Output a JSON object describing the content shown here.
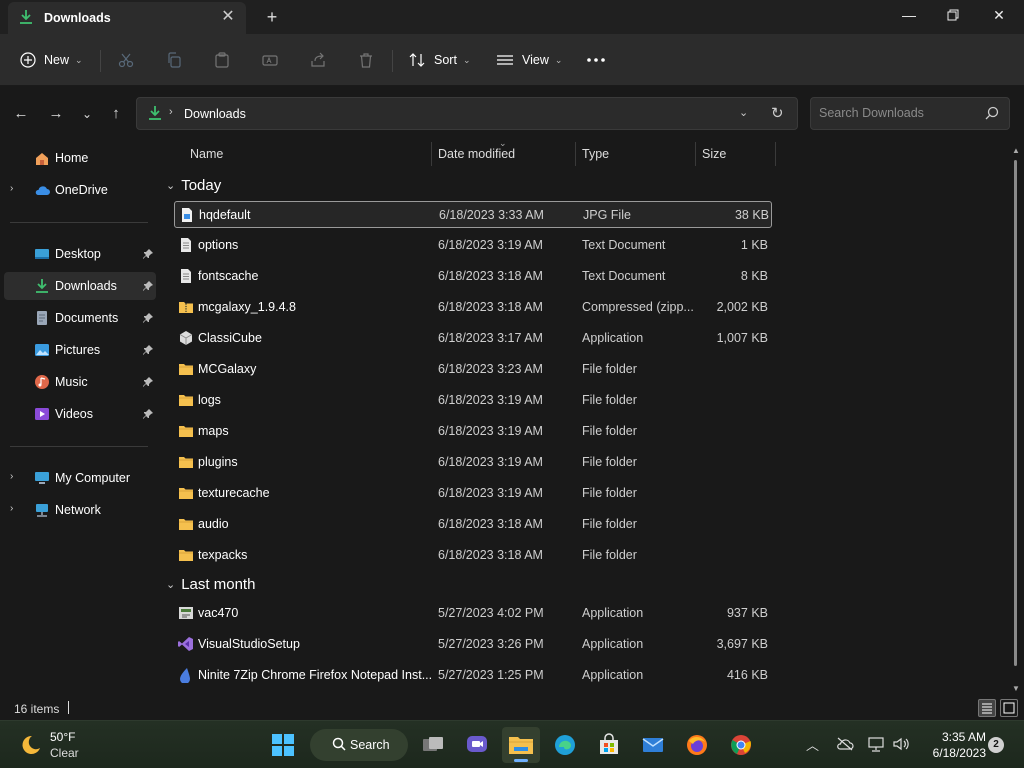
{
  "window": {
    "tab_title": "Downloads",
    "new_tab_icon": "plus-icon"
  },
  "toolbar": {
    "new_label": "New",
    "sort_label": "Sort",
    "view_label": "View"
  },
  "address": {
    "crumb": "Downloads",
    "search_placeholder": "Search Downloads"
  },
  "navigation": {
    "items": [
      {
        "label": "Home",
        "icon": "home-icon",
        "pinned": false
      },
      {
        "label": "OneDrive",
        "icon": "cloud-icon",
        "pinned": false
      },
      {
        "label": "Desktop",
        "icon": "desktop-icon",
        "pinned": true
      },
      {
        "label": "Downloads",
        "icon": "download-icon",
        "pinned": true
      },
      {
        "label": "Documents",
        "icon": "documents-icon",
        "pinned": true
      },
      {
        "label": "Pictures",
        "icon": "pictures-icon",
        "pinned": true
      },
      {
        "label": "Music",
        "icon": "music-icon",
        "pinned": true
      },
      {
        "label": "Videos",
        "icon": "videos-icon",
        "pinned": true
      },
      {
        "label": "My Computer",
        "icon": "computer-icon",
        "pinned": false
      },
      {
        "label": "Network",
        "icon": "network-icon",
        "pinned": false
      }
    ]
  },
  "columns": {
    "name": "Name",
    "date": "Date modified",
    "type": "Type",
    "size": "Size"
  },
  "groups": [
    {
      "title": "Today",
      "files": [
        {
          "name": "hqdefault",
          "date": "6/18/2023 3:33 AM",
          "type": "JPG File",
          "size": "38 KB",
          "icon": "image-file-icon"
        },
        {
          "name": "options",
          "date": "6/18/2023 3:19 AM",
          "type": "Text Document",
          "size": "1 KB",
          "icon": "text-file-icon"
        },
        {
          "name": "fontscache",
          "date": "6/18/2023 3:18 AM",
          "type": "Text Document",
          "size": "8 KB",
          "icon": "text-file-icon"
        },
        {
          "name": "mcgalaxy_1.9.4.8",
          "date": "6/18/2023 3:18 AM",
          "type": "Compressed (zipp...",
          "size": "2,002 KB",
          "icon": "zip-folder-icon"
        },
        {
          "name": "ClassiCube",
          "date": "6/18/2023 3:17 AM",
          "type": "Application",
          "size": "1,007 KB",
          "icon": "cube-app-icon"
        },
        {
          "name": "MCGalaxy",
          "date": "6/18/2023 3:23 AM",
          "type": "File folder",
          "size": "",
          "icon": "folder-icon"
        },
        {
          "name": "logs",
          "date": "6/18/2023 3:19 AM",
          "type": "File folder",
          "size": "",
          "icon": "folder-icon"
        },
        {
          "name": "maps",
          "date": "6/18/2023 3:19 AM",
          "type": "File folder",
          "size": "",
          "icon": "folder-icon"
        },
        {
          "name": "plugins",
          "date": "6/18/2023 3:19 AM",
          "type": "File folder",
          "size": "",
          "icon": "folder-icon"
        },
        {
          "name": "texturecache",
          "date": "6/18/2023 3:19 AM",
          "type": "File folder",
          "size": "",
          "icon": "folder-icon"
        },
        {
          "name": "audio",
          "date": "6/18/2023 3:18 AM",
          "type": "File folder",
          "size": "",
          "icon": "folder-icon"
        },
        {
          "name": "texpacks",
          "date": "6/18/2023 3:18 AM",
          "type": "File folder",
          "size": "",
          "icon": "folder-icon"
        }
      ]
    },
    {
      "title": "Last month",
      "files": [
        {
          "name": "vac470",
          "date": "5/27/2023 4:02 PM",
          "type": "Application",
          "size": "937 KB",
          "icon": "installer-app-icon"
        },
        {
          "name": "VisualStudioSetup",
          "date": "5/27/2023 3:26 PM",
          "type": "Application",
          "size": "3,697 KB",
          "icon": "visual-studio-icon"
        },
        {
          "name": "Ninite 7Zip Chrome Firefox Notepad Inst...",
          "date": "5/27/2023 1:25 PM",
          "type": "Application",
          "size": "416 KB",
          "icon": "ninite-icon"
        }
      ]
    }
  ],
  "status": {
    "item_count": "16 items"
  },
  "taskbar": {
    "weather_temp": "50°F",
    "weather_condition": "Clear",
    "search_label": "Search",
    "time": "3:35 AM",
    "date": "6/18/2023",
    "notification_count": "2"
  },
  "colors": {
    "folder": "#f5c04e",
    "download_accent": "#3fbf6f",
    "window_bg": "#191919",
    "toolbar_bg": "#2c2c2c"
  }
}
